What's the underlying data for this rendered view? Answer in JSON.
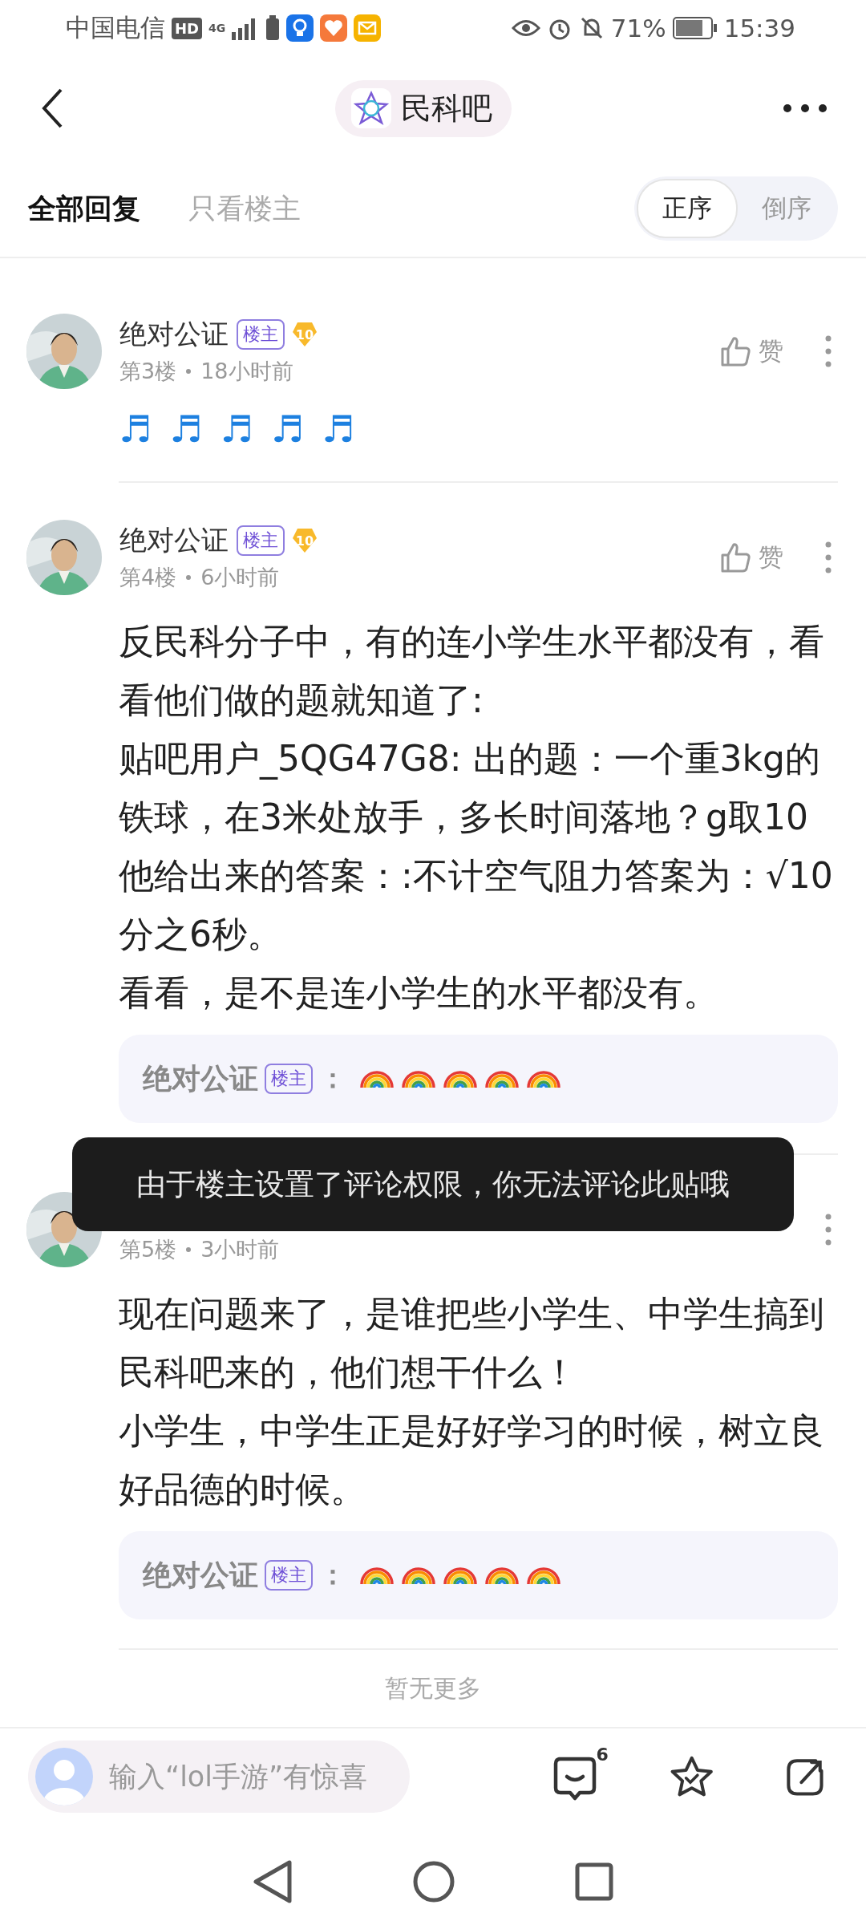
{
  "status_bar": {
    "carrier": "中国电信",
    "hd": "HD",
    "network": "4G",
    "battery": "71%",
    "time": "15:39"
  },
  "header": {
    "title": "民科吧"
  },
  "tabs": [
    {
      "label": "全部回复",
      "selected": true
    },
    {
      "label": "只看楼主",
      "selected": false
    }
  ],
  "sort": [
    {
      "label": "正序",
      "selected": true
    },
    {
      "label": "倒序",
      "selected": false
    }
  ],
  "posts": [
    {
      "author": "绝对公证",
      "badge": "楼主",
      "level": "10",
      "floor": "第3楼",
      "time": "18小时前",
      "like": "赞",
      "notes": "♬♬♬♬♬"
    },
    {
      "author": "绝对公证",
      "badge": "楼主",
      "level": "10",
      "floor": "第4楼",
      "time": "6小时前",
      "like": "赞",
      "paragraphs": [
        "反民科分子中，有的连小学生水平都没有，看看他们做的题就知道了:",
        "贴吧用户_5QG47G8: 出的题：一个重3kg的铁球，在3米处放手，多长时间落地？g取10",
        "他给出来的答案：:不计空气阻力答案为：√10分之6秒。",
        "看看，是不是连小学生的水平都没有。"
      ],
      "reply": {
        "author": "绝对公证",
        "badge": "楼主",
        "colon": "：",
        "icons": [
          {
            "kind": "rainbow"
          },
          {
            "kind": "rainbow"
          },
          {
            "kind": "rainbow"
          },
          {
            "kind": "rainbow"
          },
          {
            "kind": "rainbow"
          }
        ]
      }
    },
    {
      "floor": "第5楼",
      "time": "3小时前",
      "paragraphs": [
        "现在问题来了，是谁把些小学生、中学生搞到民科吧来的，他们想干什么！",
        "小学生，中学生正是好好学习的时候，树立良好品德的时候。"
      ],
      "reply": {
        "author": "绝对公证",
        "badge": "楼主",
        "colon": "：",
        "icons": [
          {
            "kind": "rainbow"
          },
          {
            "kind": "rainbow"
          },
          {
            "kind": "rainbow"
          },
          {
            "kind": "rainbow"
          },
          {
            "kind": "rainbow"
          }
        ]
      }
    }
  ],
  "end_text": "暂无更多",
  "toast": "由于楼主设置了评论权限，你无法评论此贴哦",
  "bottom_bar": {
    "placeholder": "输入“lol手游”有惊喜",
    "comment_count": "6"
  }
}
